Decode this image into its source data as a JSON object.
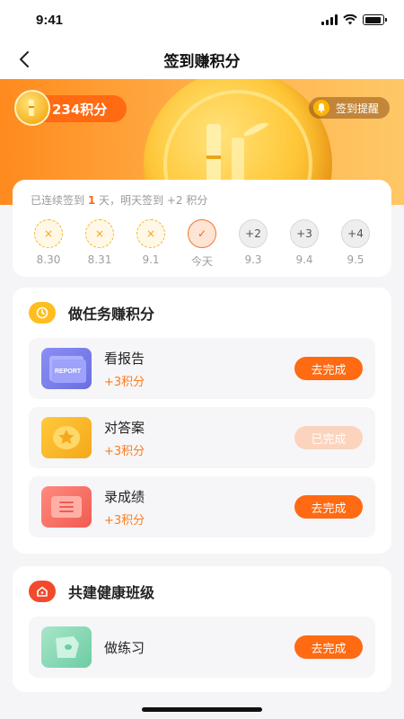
{
  "status_bar": {
    "time": "9:41"
  },
  "nav": {
    "title": "签到赚积分"
  },
  "banner": {
    "points": "234积分",
    "remind_label": "签到提醒"
  },
  "signin": {
    "streak_prefix": "已连续签到 ",
    "streak_days": "1",
    "streak_suffix": " 天，明天签到 +2 积分",
    "days": [
      {
        "label": "8.30",
        "mark": "×",
        "state": "missed"
      },
      {
        "label": "8.31",
        "mark": "×",
        "state": "missed"
      },
      {
        "label": "9.1",
        "mark": "×",
        "state": "missed"
      },
      {
        "label": "今天",
        "mark": "✓",
        "state": "today"
      },
      {
        "label": "9.3",
        "mark": "+2",
        "state": "future"
      },
      {
        "label": "9.4",
        "mark": "+3",
        "state": "future"
      },
      {
        "label": "9.5",
        "mark": "+4",
        "state": "future"
      }
    ]
  },
  "tasks_section": {
    "title": "做任务赚积分",
    "items": [
      {
        "name": "看报告",
        "points": "+3积分",
        "button": "去完成",
        "done": false,
        "thumb_text": "REPORT"
      },
      {
        "name": "对答案",
        "points": "+3积分",
        "button": "已完成",
        "done": true
      },
      {
        "name": "录成绩",
        "points": "+3积分",
        "button": "去完成",
        "done": false
      }
    ]
  },
  "class_section": {
    "title": "共建健康班级",
    "items": [
      {
        "name": "做练习",
        "button": "去完成"
      }
    ]
  },
  "colors": {
    "accent": "#ff6a12",
    "gold": "#ffbe1f",
    "done_button": "#fcd3bd"
  }
}
